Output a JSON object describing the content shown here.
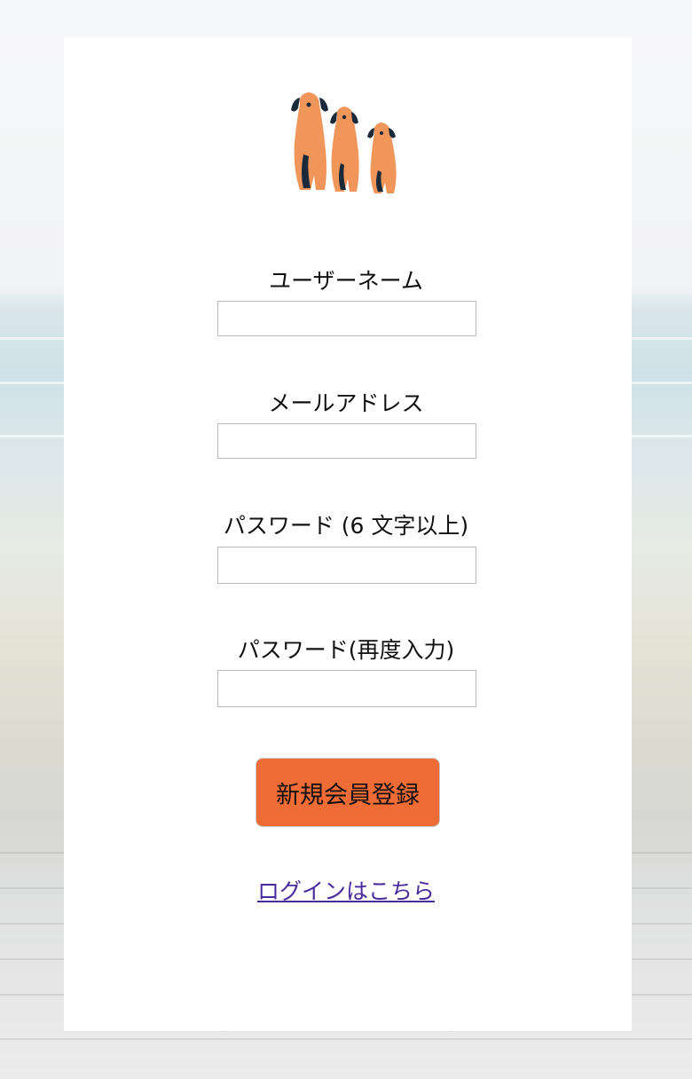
{
  "logo": {
    "icon": "three-dogs-logo-icon",
    "colors": {
      "fur": "#f0965a",
      "ears": "#1b2a3b"
    }
  },
  "form": {
    "username_label": "ユーザーネーム",
    "username_value": "",
    "email_label": "メールアドレス",
    "email_value": "",
    "password_label": "パスワード (6 文字以上)",
    "password_value": "",
    "password_confirm_label": "パスワード(再度入力)",
    "password_confirm_value": "",
    "submit_label": "新規会員登録",
    "submit_color": "#ef6c37"
  },
  "login_link": {
    "label": "ログインはこちら",
    "color": "#4b2a9b"
  }
}
